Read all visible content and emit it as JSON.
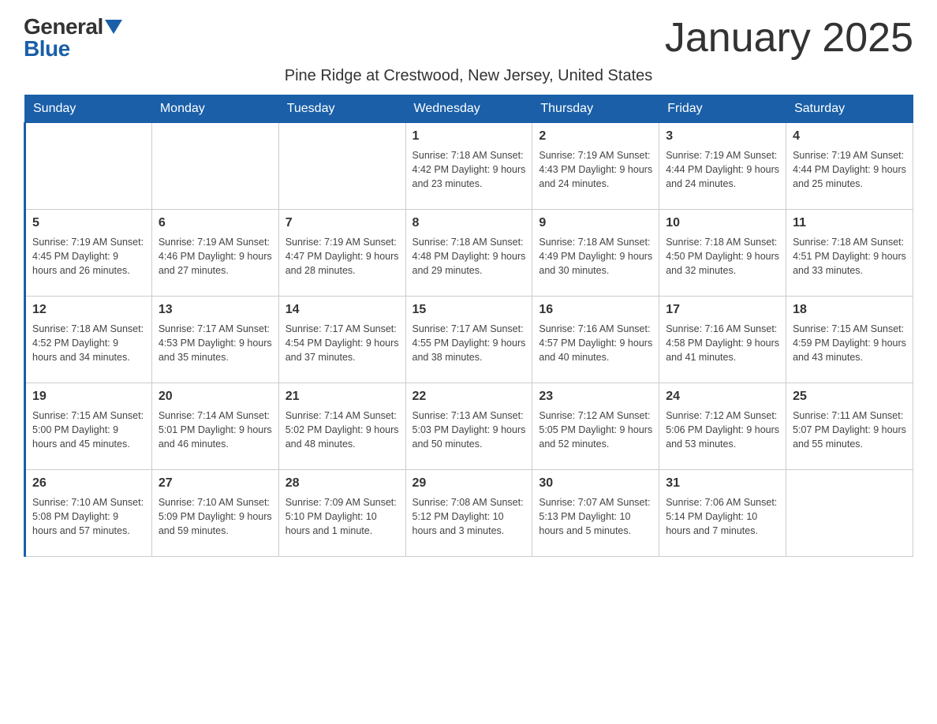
{
  "header": {
    "logo_general": "General",
    "logo_blue": "Blue",
    "month_title": "January 2025",
    "subtitle": "Pine Ridge at Crestwood, New Jersey, United States"
  },
  "weekdays": [
    "Sunday",
    "Monday",
    "Tuesday",
    "Wednesday",
    "Thursday",
    "Friday",
    "Saturday"
  ],
  "weeks": [
    [
      {
        "day": "",
        "info": ""
      },
      {
        "day": "",
        "info": ""
      },
      {
        "day": "",
        "info": ""
      },
      {
        "day": "1",
        "info": "Sunrise: 7:18 AM\nSunset: 4:42 PM\nDaylight: 9 hours\nand 23 minutes."
      },
      {
        "day": "2",
        "info": "Sunrise: 7:19 AM\nSunset: 4:43 PM\nDaylight: 9 hours\nand 24 minutes."
      },
      {
        "day": "3",
        "info": "Sunrise: 7:19 AM\nSunset: 4:44 PM\nDaylight: 9 hours\nand 24 minutes."
      },
      {
        "day": "4",
        "info": "Sunrise: 7:19 AM\nSunset: 4:44 PM\nDaylight: 9 hours\nand 25 minutes."
      }
    ],
    [
      {
        "day": "5",
        "info": "Sunrise: 7:19 AM\nSunset: 4:45 PM\nDaylight: 9 hours\nand 26 minutes."
      },
      {
        "day": "6",
        "info": "Sunrise: 7:19 AM\nSunset: 4:46 PM\nDaylight: 9 hours\nand 27 minutes."
      },
      {
        "day": "7",
        "info": "Sunrise: 7:19 AM\nSunset: 4:47 PM\nDaylight: 9 hours\nand 28 minutes."
      },
      {
        "day": "8",
        "info": "Sunrise: 7:18 AM\nSunset: 4:48 PM\nDaylight: 9 hours\nand 29 minutes."
      },
      {
        "day": "9",
        "info": "Sunrise: 7:18 AM\nSunset: 4:49 PM\nDaylight: 9 hours\nand 30 minutes."
      },
      {
        "day": "10",
        "info": "Sunrise: 7:18 AM\nSunset: 4:50 PM\nDaylight: 9 hours\nand 32 minutes."
      },
      {
        "day": "11",
        "info": "Sunrise: 7:18 AM\nSunset: 4:51 PM\nDaylight: 9 hours\nand 33 minutes."
      }
    ],
    [
      {
        "day": "12",
        "info": "Sunrise: 7:18 AM\nSunset: 4:52 PM\nDaylight: 9 hours\nand 34 minutes."
      },
      {
        "day": "13",
        "info": "Sunrise: 7:17 AM\nSunset: 4:53 PM\nDaylight: 9 hours\nand 35 minutes."
      },
      {
        "day": "14",
        "info": "Sunrise: 7:17 AM\nSunset: 4:54 PM\nDaylight: 9 hours\nand 37 minutes."
      },
      {
        "day": "15",
        "info": "Sunrise: 7:17 AM\nSunset: 4:55 PM\nDaylight: 9 hours\nand 38 minutes."
      },
      {
        "day": "16",
        "info": "Sunrise: 7:16 AM\nSunset: 4:57 PM\nDaylight: 9 hours\nand 40 minutes."
      },
      {
        "day": "17",
        "info": "Sunrise: 7:16 AM\nSunset: 4:58 PM\nDaylight: 9 hours\nand 41 minutes."
      },
      {
        "day": "18",
        "info": "Sunrise: 7:15 AM\nSunset: 4:59 PM\nDaylight: 9 hours\nand 43 minutes."
      }
    ],
    [
      {
        "day": "19",
        "info": "Sunrise: 7:15 AM\nSunset: 5:00 PM\nDaylight: 9 hours\nand 45 minutes."
      },
      {
        "day": "20",
        "info": "Sunrise: 7:14 AM\nSunset: 5:01 PM\nDaylight: 9 hours\nand 46 minutes."
      },
      {
        "day": "21",
        "info": "Sunrise: 7:14 AM\nSunset: 5:02 PM\nDaylight: 9 hours\nand 48 minutes."
      },
      {
        "day": "22",
        "info": "Sunrise: 7:13 AM\nSunset: 5:03 PM\nDaylight: 9 hours\nand 50 minutes."
      },
      {
        "day": "23",
        "info": "Sunrise: 7:12 AM\nSunset: 5:05 PM\nDaylight: 9 hours\nand 52 minutes."
      },
      {
        "day": "24",
        "info": "Sunrise: 7:12 AM\nSunset: 5:06 PM\nDaylight: 9 hours\nand 53 minutes."
      },
      {
        "day": "25",
        "info": "Sunrise: 7:11 AM\nSunset: 5:07 PM\nDaylight: 9 hours\nand 55 minutes."
      }
    ],
    [
      {
        "day": "26",
        "info": "Sunrise: 7:10 AM\nSunset: 5:08 PM\nDaylight: 9 hours\nand 57 minutes."
      },
      {
        "day": "27",
        "info": "Sunrise: 7:10 AM\nSunset: 5:09 PM\nDaylight: 9 hours\nand 59 minutes."
      },
      {
        "day": "28",
        "info": "Sunrise: 7:09 AM\nSunset: 5:10 PM\nDaylight: 10 hours\nand 1 minute."
      },
      {
        "day": "29",
        "info": "Sunrise: 7:08 AM\nSunset: 5:12 PM\nDaylight: 10 hours\nand 3 minutes."
      },
      {
        "day": "30",
        "info": "Sunrise: 7:07 AM\nSunset: 5:13 PM\nDaylight: 10 hours\nand 5 minutes."
      },
      {
        "day": "31",
        "info": "Sunrise: 7:06 AM\nSunset: 5:14 PM\nDaylight: 10 hours\nand 7 minutes."
      },
      {
        "day": "",
        "info": ""
      }
    ]
  ]
}
